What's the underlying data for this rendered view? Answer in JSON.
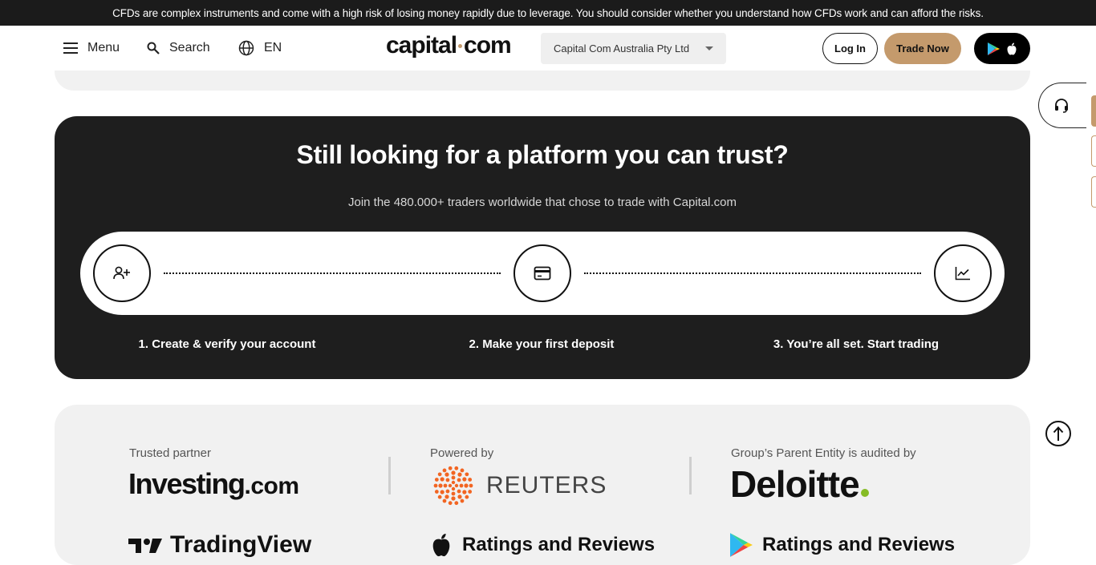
{
  "risk_warning": "CFDs are complex instruments and come with a high risk of losing money rapidly due to leverage. You should consider whether you understand how CFDs work and can afford the risks.",
  "header": {
    "menu_label": "Menu",
    "search_label": "Search",
    "language": "EN",
    "logo_left": "capital",
    "logo_right": "com",
    "entity_selected": "Capital Com Australia Pty Ltd",
    "login_label": "Log In",
    "trade_label": "Trade Now"
  },
  "promo": {
    "title": "Still looking for a platform you can trust?",
    "subtitle": "Join the 480.000+ traders worldwide that chose to trade with Capital.com",
    "steps": [
      {
        "label": "1. Create & verify your account",
        "icon": "add-user-icon"
      },
      {
        "label": "2. Make your first deposit",
        "icon": "credit-card-icon"
      },
      {
        "label": "3. You’re all set. Start trading",
        "icon": "chart-line-icon"
      }
    ]
  },
  "partners": {
    "items": [
      {
        "caption": "Trusted partner",
        "brand": "Investing",
        "brand_suffix": ".com"
      },
      {
        "caption": "Powered by",
        "brand": "REUTERS"
      },
      {
        "caption": "Group’s Parent Entity is audited by",
        "brand": "Deloitte"
      }
    ],
    "row2": {
      "tradingview": "TradingView",
      "apple_rating": "Ratings and Reviews",
      "google_rating": "Ratings and Reviews"
    }
  },
  "colors": {
    "accent": "#c49a6c",
    "dark_card": "#1e1e1e",
    "risk_bar": "#1b1b1b",
    "reuters_orange": "#f26522",
    "deloitte_green": "#86bc25"
  }
}
